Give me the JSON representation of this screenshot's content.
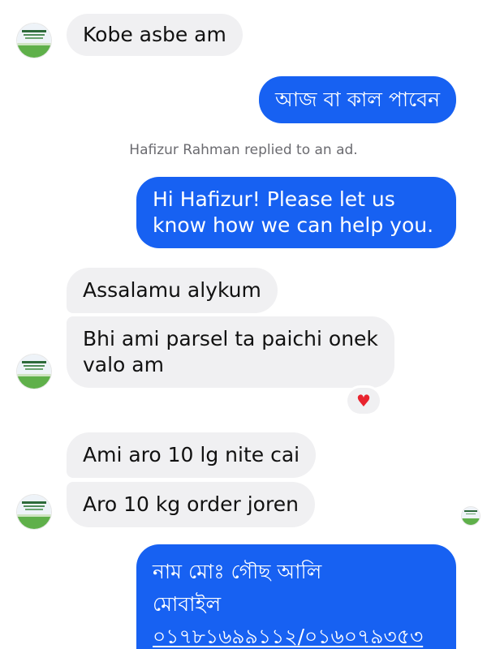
{
  "messages": {
    "m1": {
      "text": "Kobe asbe am"
    },
    "m2": {
      "text": "আজ বা কাল পাবেন"
    },
    "system_notice": "Hafizur Rahman replied to an ad.",
    "m3": {
      "line1": "Hi Hafizur! Please let us",
      "line2": "know how we can help you."
    },
    "m4": {
      "text": "Assalamu alykum"
    },
    "m5": {
      "line1": "Bhi ami parsel ta paichi onek",
      "line2": "valo am"
    },
    "m5_reaction": "♥",
    "m6": {
      "text": "Ami aro 10 lg nite cai"
    },
    "m7": {
      "text": "Aro 10 kg order joren"
    },
    "m8": {
      "line1": "নাম মোঃ গৌছ আলি",
      "line2": "মোবাইল",
      "line3": "০১৭৮১৬৯৯১১২/০১৬০৭৯৩৫৩"
    }
  },
  "colors": {
    "outgoing_bubble": "#1761f2",
    "incoming_bubble": "#f0f0f2",
    "reaction_heart": "#e8232e",
    "system_text": "#6b6b70"
  },
  "icons": {
    "avatar": "rice-field-logo-avatar",
    "reaction": "heart-icon",
    "read_receipt": "seen-avatar-icon"
  }
}
